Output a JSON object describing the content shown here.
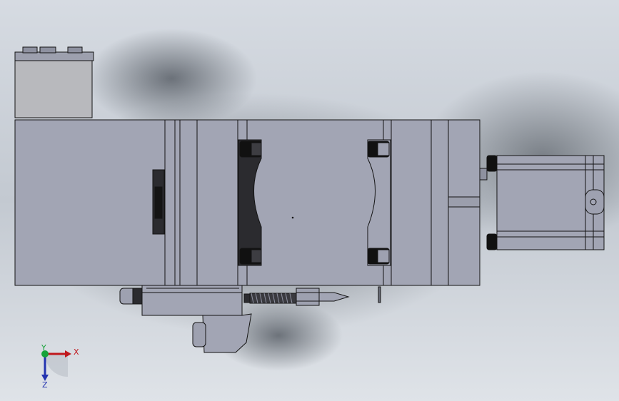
{
  "viewport": {
    "background_colors": [
      "#dde2e8",
      "#a8b0bb",
      "#c5ccd4"
    ],
    "part_fill": "#a2a5b4",
    "part_fill_dark": "#8e91a0",
    "edge_color": "#141414",
    "dark_fill": "#2b2b2f"
  },
  "triad": {
    "x_label": "X",
    "y_label": "Y",
    "z_label": "Z",
    "x_color": "#c0171c",
    "y_color": "#17a33a",
    "z_color": "#2333b0"
  }
}
